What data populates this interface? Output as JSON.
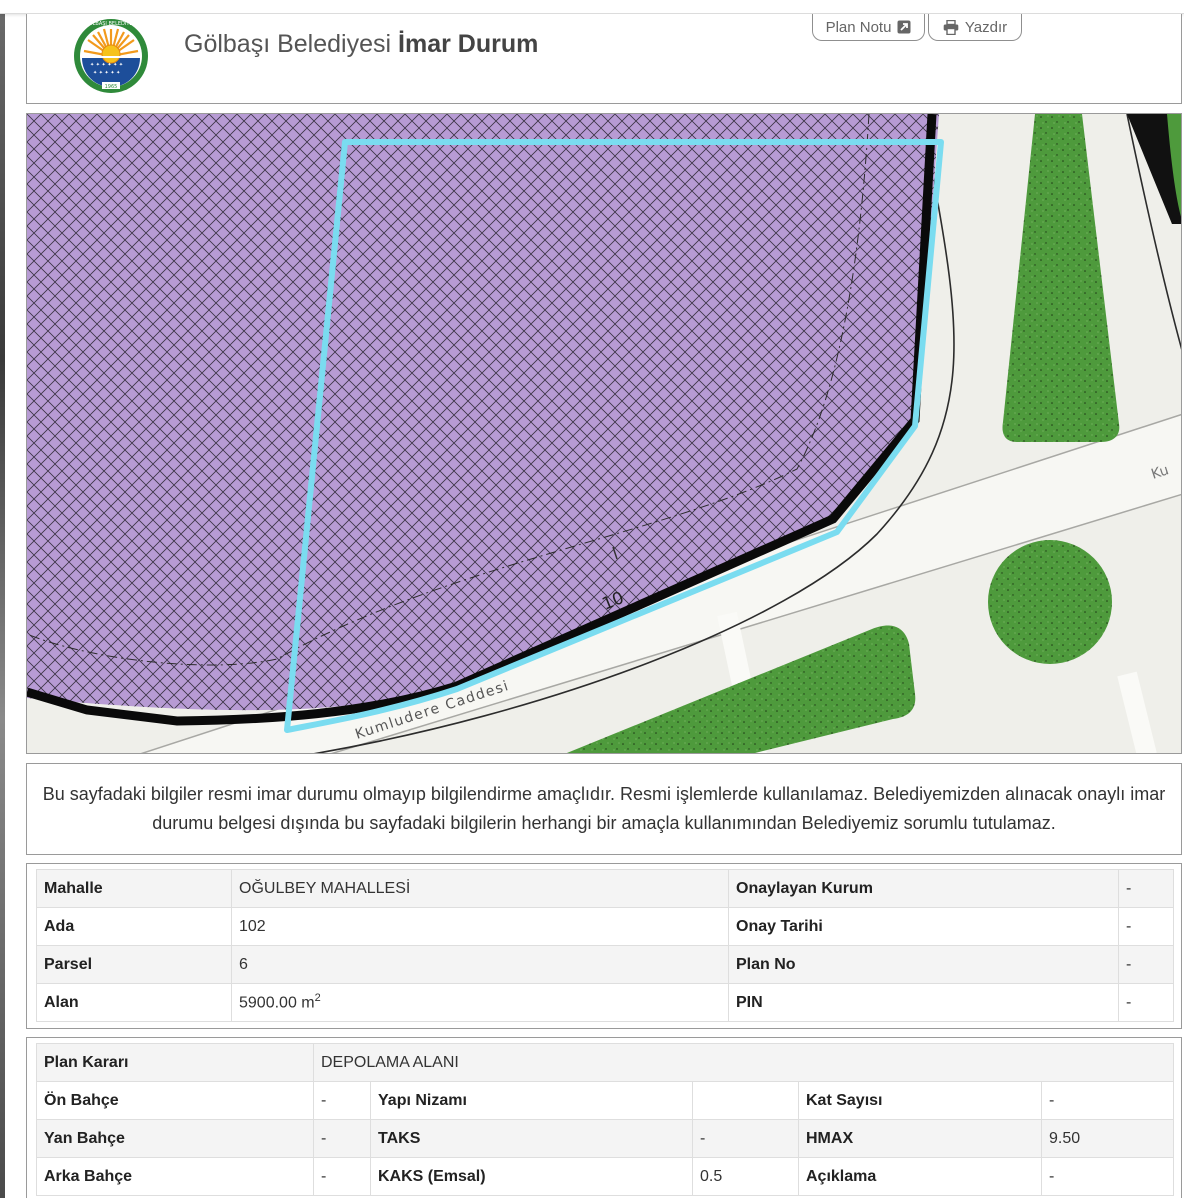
{
  "header": {
    "title_prefix": "Gölbaşı Belediyesi",
    "title_bold": "İmar Durum",
    "plan_notu_label": "Plan Notu",
    "yazdir_label": "Yazdır",
    "logo_top_text": "GÖLBAŞI BELEDİYESİ",
    "logo_year": "1965"
  },
  "map": {
    "street_label": "Kumludere Caddesi",
    "street_label_right": "Ku",
    "contour_label": "10",
    "colors": {
      "parcel_fill": "#b79bd4",
      "parcel_outline": "#7adcf0",
      "park": "#4e9a3c",
      "road": "#f6f6f2"
    }
  },
  "notice": {
    "text": "Bu sayfadaki bilgiler resmi imar durumu olmayıp bilgilendirme amaçlıdır. Resmi işlemlerde kullanılamaz. Belediyemizden alınacak onaylı imar durumu belgesi dışında bu sayfadaki bilgilerin herhangi bir amaçla kullanımından Belediyemiz sorumlu tutulamaz."
  },
  "parcel": {
    "mahalle_label": "Mahalle",
    "mahalle_value": "OĞULBEY MAHALLESİ",
    "ada_label": "Ada",
    "ada_value": "102",
    "parsel_label": "Parsel",
    "parsel_value": "6",
    "alan_label": "Alan",
    "alan_value": "5900.00 m",
    "alan_unit_sup": "2",
    "kurum_label": "Onaylayan Kurum",
    "kurum_value": "-",
    "tarih_label": "Onay Tarihi",
    "tarih_value": "-",
    "planno_label": "Plan No",
    "planno_value": "-",
    "pin_label": "PIN",
    "pin_value": "-"
  },
  "plan": {
    "karar_label": "Plan Kararı",
    "karar_value": "DEPOLAMA ALANI",
    "on_bahce_label": "Ön Bahçe",
    "on_bahce_value": "-",
    "yapi_nizami_label": "Yapı Nizamı",
    "yapi_nizami_value": "",
    "kat_sayisi_label": "Kat Sayısı",
    "kat_sayisi_value": "-",
    "yan_bahce_label": "Yan Bahçe",
    "yan_bahce_value": "-",
    "taks_label": "TAKS",
    "taks_value": "-",
    "hmax_label": "HMAX",
    "hmax_value": "9.50",
    "arka_bahce_label": "Arka Bahçe",
    "arka_bahce_value": "-",
    "kaks_label": "KAKS (Emsal)",
    "kaks_value": "0.5",
    "aciklama_label": "Açıklama",
    "aciklama_value": "-"
  }
}
